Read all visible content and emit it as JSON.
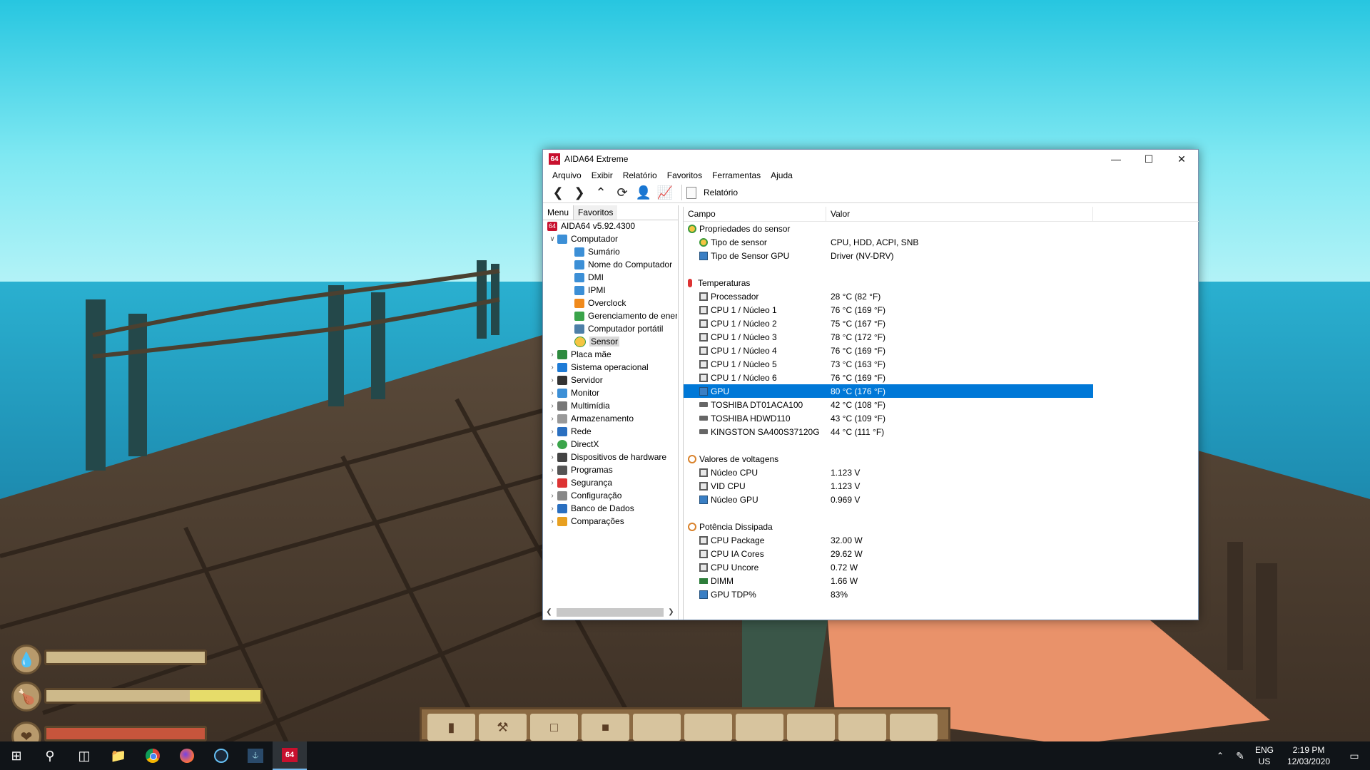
{
  "window": {
    "title": "AIDA64 Extreme",
    "logo": "64",
    "menu": [
      "Arquivo",
      "Exibir",
      "Relatório",
      "Favoritos",
      "Ferramentas",
      "Ajuda"
    ],
    "toolbar_report_label": "Relatório",
    "left_tabs": [
      "Menu",
      "Favoritos"
    ],
    "tree": {
      "root": "AIDA64 v5.92.4300",
      "computador": "Computador",
      "children": [
        "Sumário",
        "Nome do Computador",
        "DMI",
        "IPMI",
        "Overclock",
        "Gerenciamento de ener",
        "Computador portátil",
        "Sensor"
      ],
      "top_level": [
        "Placa mãe",
        "Sistema operacional",
        "Servidor",
        "Monitor",
        "Multimídia",
        "Armazenamento",
        "Rede",
        "DirectX",
        "Dispositivos de hardware",
        "Programas",
        "Segurança",
        "Configuração",
        "Banco de Dados",
        "Comparações"
      ]
    },
    "columns": {
      "field": "Campo",
      "value": "Valor"
    },
    "sections": {
      "sensor_props": {
        "title": "Propriedades do sensor",
        "rows": [
          {
            "f": "Tipo de sensor",
            "v": "CPU, HDD, ACPI, SNB"
          },
          {
            "f": "Tipo de Sensor GPU",
            "v": "Driver  (NV-DRV)"
          }
        ]
      },
      "temps": {
        "title": "Temperaturas",
        "rows": [
          {
            "f": "Processador",
            "v": "28 °C  (82 °F)"
          },
          {
            "f": "CPU 1 / Núcleo 1",
            "v": "76 °C  (169 °F)"
          },
          {
            "f": "CPU 1 / Núcleo 2",
            "v": "75 °C  (167 °F)"
          },
          {
            "f": "CPU 1 / Núcleo 3",
            "v": "78 °C  (172 °F)"
          },
          {
            "f": "CPU 1 / Núcleo 4",
            "v": "76 °C  (169 °F)"
          },
          {
            "f": "CPU 1 / Núcleo 5",
            "v": "73 °C  (163 °F)"
          },
          {
            "f": "CPU 1 / Núcleo 6",
            "v": "76 °C  (169 °F)"
          },
          {
            "f": "GPU",
            "v": "80 °C  (176 °F)"
          },
          {
            "f": "TOSHIBA DT01ACA100",
            "v": "42 °C  (108 °F)"
          },
          {
            "f": "TOSHIBA HDWD110",
            "v": "43 °C  (109 °F)"
          },
          {
            "f": "KINGSTON SA400S37120G",
            "v": "44 °C  (111 °F)"
          }
        ]
      },
      "volts": {
        "title": "Valores de voltagens",
        "rows": [
          {
            "f": "Núcleo CPU",
            "v": "1.123 V"
          },
          {
            "f": "VID CPU",
            "v": "1.123 V"
          },
          {
            "f": "Núcleo GPU",
            "v": "0.969 V"
          }
        ]
      },
      "power": {
        "title": "Potência Dissipada",
        "rows": [
          {
            "f": "CPU Package",
            "v": "32.00 W"
          },
          {
            "f": "CPU IA Cores",
            "v": "29.62 W"
          },
          {
            "f": "CPU Uncore",
            "v": "0.72 W"
          },
          {
            "f": "DIMM",
            "v": "1.66 W"
          },
          {
            "f": "GPU TDP%",
            "v": "83%"
          }
        ]
      }
    }
  },
  "taskbar": {
    "lang": "ENG",
    "region": "US",
    "time": "2:19 PM",
    "date": "12/03/2020",
    "aida_label": "64"
  },
  "hud": {
    "hunger_level": 0.67
  },
  "colors": {
    "selection": "#0078d7",
    "accent": "#c8102e"
  }
}
